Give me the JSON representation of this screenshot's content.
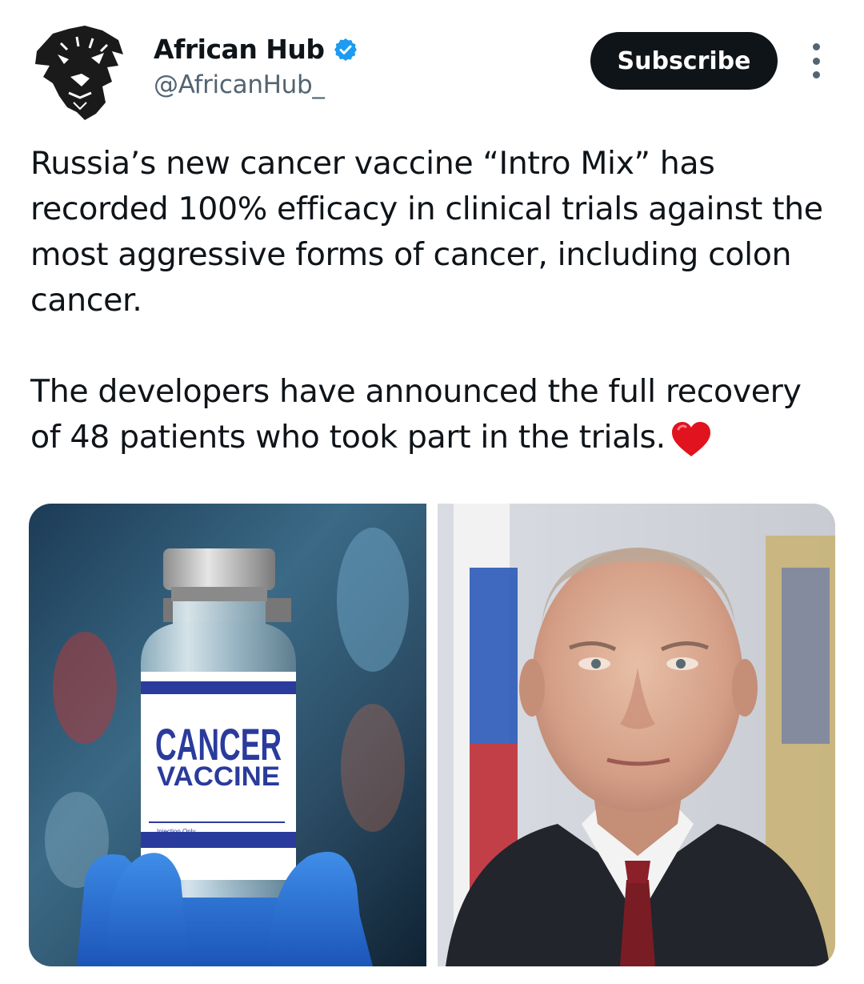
{
  "author": {
    "display_name": "African Hub",
    "handle": "@AfricanHub_",
    "verified": true,
    "verified_color": "#1d9bf0",
    "avatar_icon": "tiger-head-icon"
  },
  "actions": {
    "subscribe_label": "Subscribe",
    "more_icon": "more-vertical-icon"
  },
  "post": {
    "paragraph_1": "Russia’s new cancer vaccine “Intro Mix” has recorded 100% efficacy in clinical trials against the most aggressive forms of cancer, including colon cancer.",
    "paragraph_2": "The developers have announced the full recovery of 48 patients who took part in the trials.",
    "emoji": "red-heart-icon"
  },
  "media": {
    "image_1": {
      "label_line_1": "CANCER",
      "label_line_2": "VACCINE",
      "small_text": "Injection Only"
    },
    "image_2": {
      "subject": "man-in-suit-portrait"
    }
  },
  "colors": {
    "text_primary": "#0f1419",
    "text_secondary": "#536471",
    "button_bg": "#0f1419",
    "label_blue": "#2a3b9c"
  }
}
